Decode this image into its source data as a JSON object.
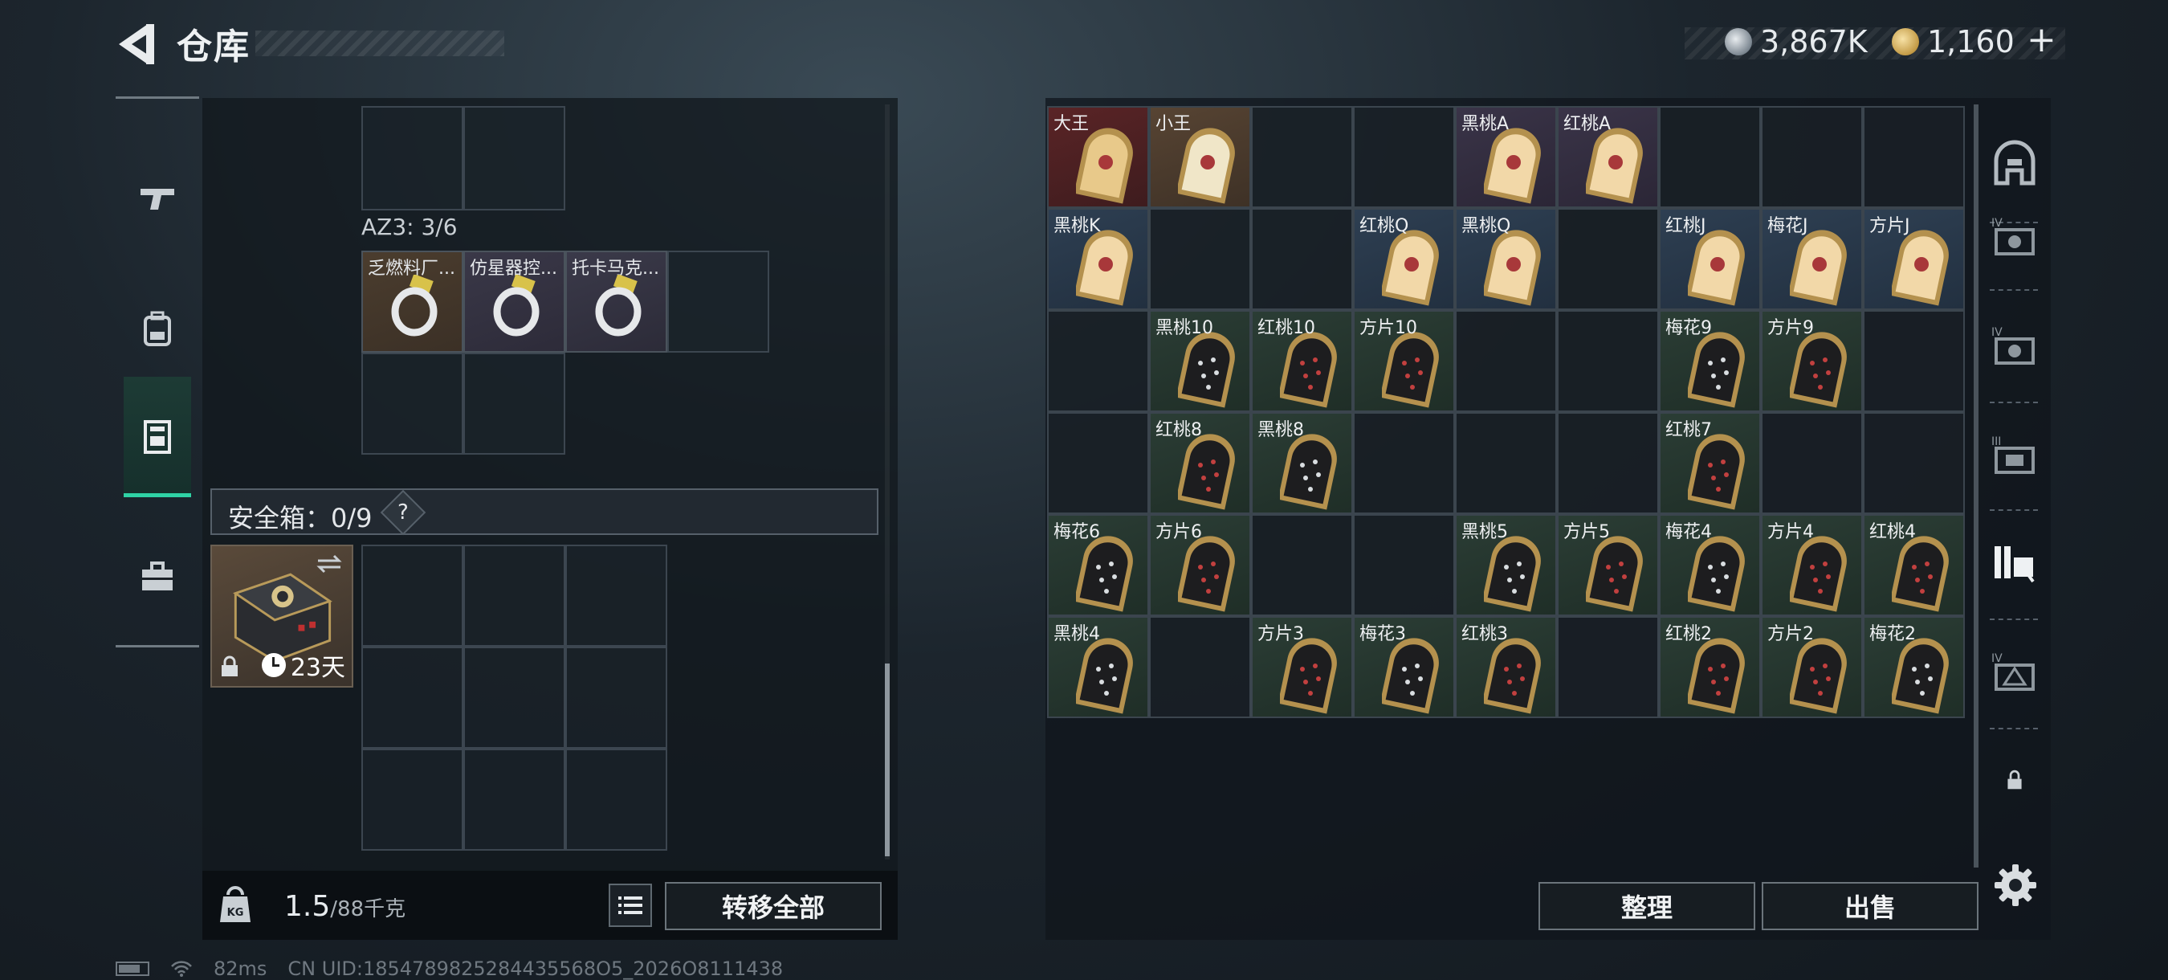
{
  "header": {
    "title": "仓库",
    "currency_silver": "3,867K",
    "currency_gold": "1,160",
    "add_label": "+"
  },
  "left_tabs": [
    {
      "name": "weapons",
      "icon": "pistol-icon",
      "active": false
    },
    {
      "name": "gear",
      "icon": "backpack-icon",
      "active": false
    },
    {
      "name": "container",
      "icon": "container-icon",
      "active": true
    },
    {
      "name": "toolbox",
      "icon": "toolbox-icon",
      "active": false
    }
  ],
  "storage": {
    "az3_label": "AZ3: 3/6",
    "items": [
      {
        "label": "乏燃料厂...",
        "icon": "cable-tie-icon"
      },
      {
        "label": "仿星器控...",
        "icon": "cable-tie-icon"
      },
      {
        "label": "托卡马克...",
        "icon": "cable-tie-icon"
      }
    ],
    "safe_box_label": "安全箱：0/9",
    "help_label": "?",
    "safe_item_days": "23天",
    "weight_current": "1.5",
    "weight_max": "/88千克",
    "transfer_all": "转移全部"
  },
  "cards": {
    "rows": [
      [
        "大王",
        "小王",
        "",
        "",
        "黑桃A",
        "红桃A",
        "",
        "",
        ""
      ],
      [
        "黑桃K",
        "",
        "",
        "红桃Q",
        "黑桃Q",
        "",
        "红桃J",
        "梅花J",
        "方片J"
      ],
      [
        "",
        "黑桃10",
        "红桃10",
        "方片10",
        "",
        "",
        "梅花9",
        "方片9",
        ""
      ],
      [
        "",
        "红桃8",
        "黑桃8",
        "",
        "",
        "",
        "红桃7",
        "",
        ""
      ],
      [
        "梅花6",
        "方片6",
        "",
        "",
        "黑桃5",
        "方片5",
        "梅花4",
        "方片4",
        "红桃4"
      ],
      [
        "黑桃4",
        "",
        "方片3",
        "梅花3",
        "红桃3",
        "",
        "红桃2",
        "方片2",
        "梅花2"
      ]
    ]
  },
  "actions": {
    "sort": "整理",
    "sell": "出售"
  },
  "footer": {
    "ping": "82ms",
    "uid": "CN UID:1854789825284435568O5_2026O8111438"
  }
}
